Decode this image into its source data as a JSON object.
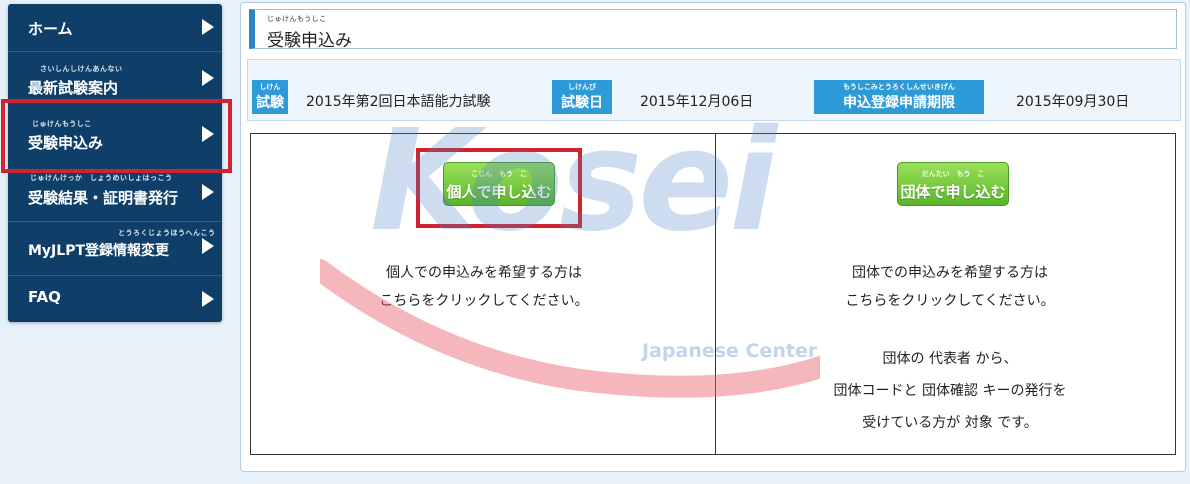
{
  "sidebar": {
    "items": [
      {
        "ruby": "",
        "label": "ホーム"
      },
      {
        "ruby": "さいしんしけんあんない",
        "label": "最新試験案内"
      },
      {
        "ruby": "じゅけんもうしこ",
        "label": "受験申込み"
      },
      {
        "ruby": "じゅけんけっか　しょうめいしょはっこう",
        "label": "受験結果・証明書発行"
      },
      {
        "ruby": "とうろくじょうほうへんこう",
        "label": "MyJLPT登録情報変更"
      },
      {
        "ruby": "",
        "label": "FAQ"
      }
    ]
  },
  "page": {
    "title_ruby": "じゅけんもうしこ",
    "title": "受験申込み"
  },
  "exam_info": {
    "exam_badge_ruby": "しけん",
    "exam_badge": "試験",
    "exam_name": "2015年第2回日本語能力試験",
    "date_badge_ruby": "しけんび",
    "date_badge": "試験日",
    "exam_date": "2015年12月06日",
    "deadline_badge_ruby": "もうしこみとうろくしんせいきげん",
    "deadline_badge": "申込登録申請期限",
    "deadline_date": "2015年09月30日"
  },
  "individual": {
    "button_ruby": "こじん　もう　こ",
    "button_label": "個人で申し込む",
    "desc_line1": "個人での申込みを希望する方は",
    "desc_line2": "こちらをクリックしてください。"
  },
  "group": {
    "button_ruby": "だんたい　もう　こ",
    "button_label": "団体で申し込む",
    "desc_line1": "団体での申込みを希望する方は",
    "desc_line2": "こちらをクリックしてください。",
    "note_line1": "団体の 代表者 から、",
    "note_line2": "団体コードと 団体確認 キーの発行を",
    "note_line3": "受けている方が 対象 です。"
  },
  "watermark": {
    "brand": "Kosei",
    "sub": "Japanese Center"
  },
  "colors": {
    "sidebar_bg": "#0f3f69",
    "badge_blue": "#2e9ad8",
    "button_green": "#59b52a",
    "highlight_red": "#d0232f",
    "watermark_blue": "#5082c8",
    "watermark_pink": "#e8606a"
  }
}
